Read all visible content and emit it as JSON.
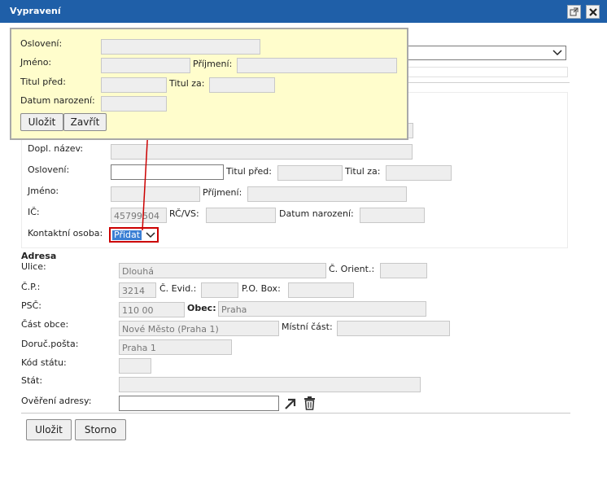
{
  "window": {
    "title": "Vypravení"
  },
  "icons": {
    "popout": "popout-icon",
    "close": "close-icon",
    "search": "search-address-icon",
    "trash": "trash-icon"
  },
  "popup": {
    "osloveni": "Oslovení:",
    "jmeno": "Jméno:",
    "prijmeni": "Příjmení:",
    "titul_pred": "Titul před:",
    "titul_za": "Titul za:",
    "datum_narozeni": "Datum narození:",
    "save": "Uložit",
    "close": "Zavřít"
  },
  "form": {
    "dopl_nazev": "Dopl. název:",
    "osloveni": "Oslovení:",
    "titul_pred": "Titul před:",
    "titul_za": "Titul za:",
    "jmeno": "Jméno:",
    "prijmeni": "Příjmení:",
    "ic": "IČ:",
    "ic_value": "45799504",
    "rc_vs": "RČ/VS:",
    "datum_narozeni": "Datum narození:",
    "kontaktni_osoba": "Kontaktní osoba:",
    "kontaktni_osoba_value": "Přidat"
  },
  "address": {
    "heading": "Adresa",
    "ulice": "Ulice:",
    "ulice_value": "Dlouhá",
    "c_orient": "Č. Orient.:",
    "cp": "Č.P.:",
    "cp_value": "3214",
    "c_evid": "Č. Evid.:",
    "po_box": "P.O. Box:",
    "psc": "PSČ:",
    "psc_value": "110 00",
    "obec": "Obec:",
    "obec_value": "Praha",
    "cast_obce": "Část obce:",
    "cast_obce_value": "Nové Město (Praha 1)",
    "mistni_cast": "Místní část:",
    "doruc_posta": "Doruč.pošta:",
    "doruc_posta_value": "Praha 1",
    "kod_statu": "Kód státu:",
    "stat": "Stát:",
    "overeni": "Ověření adresy:"
  },
  "footer": {
    "save": "Uložit",
    "cancel": "Storno"
  },
  "colors": {
    "titlebar": "#1f5fa8",
    "popup_bg": "#fffdcc",
    "highlight": "#cc0000",
    "selected": "#3b7fd4"
  }
}
